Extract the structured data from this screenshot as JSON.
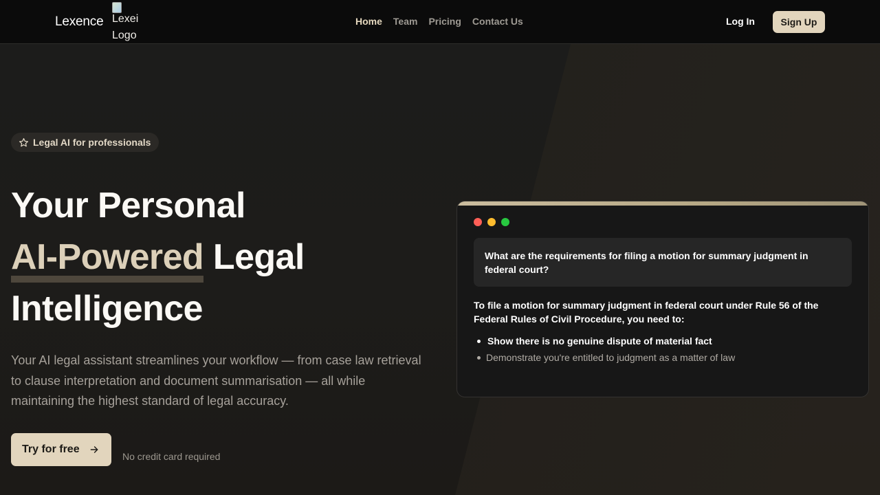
{
  "header": {
    "brand": "Lexence",
    "logo_alt_line1": "Lexei",
    "logo_alt_line2": "Logo",
    "nav": [
      {
        "label": "Home",
        "active": true
      },
      {
        "label": "Team",
        "active": false
      },
      {
        "label": "Pricing",
        "active": false
      },
      {
        "label": "Contact Us",
        "active": false
      }
    ],
    "login_label": "Log In",
    "signup_label": "Sign Up"
  },
  "hero": {
    "badge_icon": "star-icon",
    "badge_label": "Legal AI for professionals",
    "title_line1": "Your Personal",
    "title_accent": "AI-Powered",
    "title_line2_rest": " Legal",
    "title_line3": "Intelligence",
    "lead": "Your AI legal assistant streamlines your workflow — from case law retrieval to clause interpretation and document summarisation — all while maintaining the highest standard of legal accuracy.",
    "cta_label": "Try for free",
    "cta_icon": "arrow-right-icon",
    "cta_note": "No credit card required"
  },
  "chat": {
    "window_dots": [
      "#ff5f57",
      "#febc2e",
      "#28c840"
    ],
    "question": "What are the requirements for filing a motion for summary judgment in federal court?",
    "answer_intro": "To file a motion for summary judgment in federal court under Rule 56 of the Federal Rules of Civil Procedure, you need to:",
    "answer_points": [
      "Show there is no genuine dispute of material fact",
      "Demonstrate you're entitled to judgment as a matter of law"
    ]
  },
  "colors": {
    "accent": "#e2d5bd",
    "header_bg": "#0b0b0b",
    "card_bg": "#171717"
  }
}
